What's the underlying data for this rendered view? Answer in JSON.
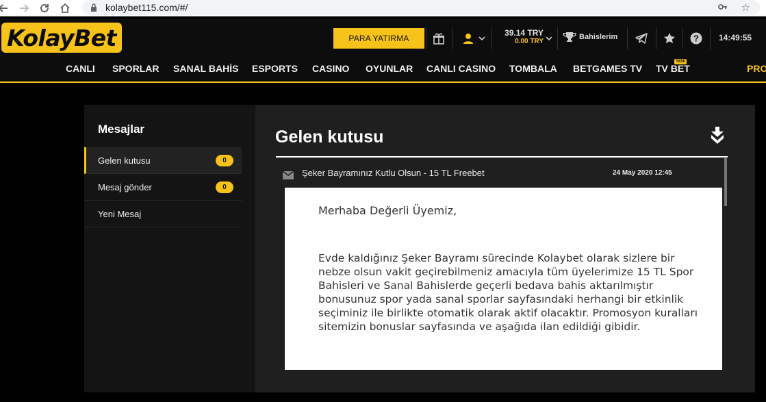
{
  "browser": {
    "url": "kolaybet115.com/#/"
  },
  "header": {
    "logo_text": "KolayBet",
    "deposit_label": "PARA YATIRMA",
    "balance": "39.14 TRY",
    "bonus_balance": "0.00 TRY",
    "bets_label": "Bahislerim",
    "time": "14:49:55",
    "accent_color": "#f7c21a"
  },
  "nav": {
    "items": [
      "CANLI",
      "SPORLAR",
      "SANAL BAHİS",
      "ESPORTS",
      "CASINO",
      "OYUNLAR",
      "CANLI CASINO",
      "TOMBALA",
      "BETGAMES TV",
      "TV BET",
      "PRO"
    ],
    "new_badge": "YENİ"
  },
  "sidebar": {
    "title": "Mesajlar",
    "items": [
      {
        "label": "Gelen kutusu",
        "count": "0"
      },
      {
        "label": "Mesaj gönder",
        "count": "0"
      },
      {
        "label": "Yeni Mesaj"
      }
    ]
  },
  "inbox": {
    "title": "Gelen kutusu",
    "message": {
      "subject": "Şeker Bayramınız Kutlu Olsun - 15 TL Freebet",
      "date": "24 May 2020 12:45",
      "greeting": "Merhaba Değerli Üyemiz,",
      "body": "Evde kaldığınız Şeker Bayramı sürecinde Kolaybet olarak sizlere bir nebze olsun vakit geçirebilmeniz amacıyla tüm üyelerimize 15 TL Spor Bahisleri ve Sanal Bahislerde geçerli bedava bahis aktarılmıştır bonusunuz spor yada sanal sporlar sayfasındaki herhangi bir etkinlik seçiminiz ile birlikte otomatik olarak aktif olacaktır. Promosyon kuralları sitemizin bonuslar sayfasında ve aşağıda ilan edildiği gibidir."
    }
  }
}
